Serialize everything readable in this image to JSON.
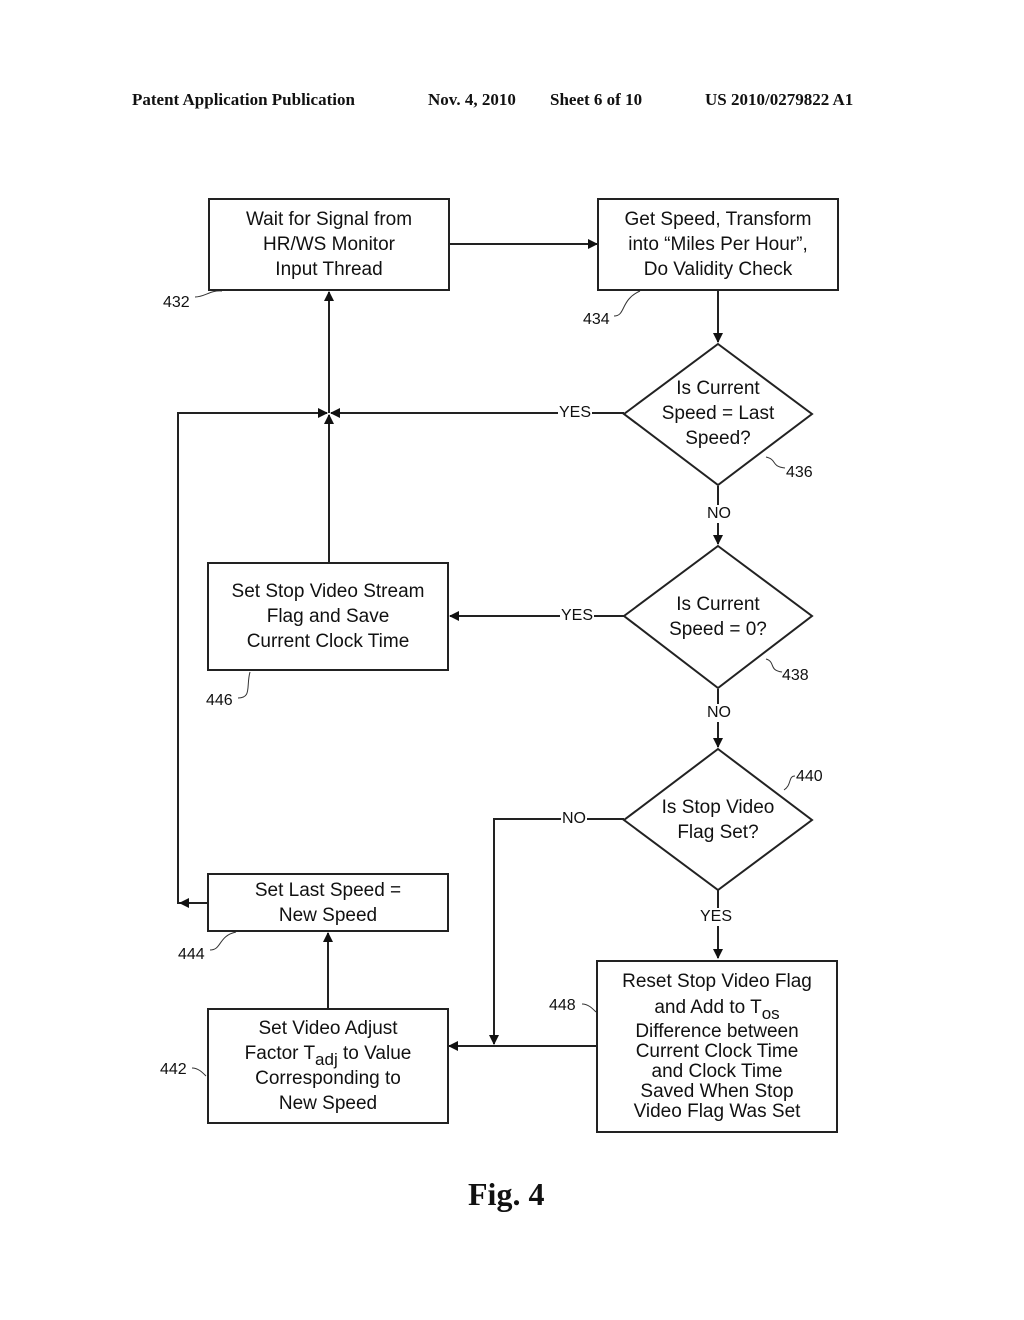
{
  "header": {
    "publication": "Patent Application Publication",
    "date": "Nov. 4, 2010",
    "sheet": "Sheet 6 of 10",
    "number": "US 2010/0279822 A1"
  },
  "figure_label": "Fig. 4",
  "nodes": {
    "n432": {
      "ref": "432",
      "lines": [
        "Wait for Signal from",
        "HR/WS Monitor",
        "Input Thread"
      ]
    },
    "n434": {
      "ref": "434",
      "lines": [
        "Get Speed, Transform",
        "into “Miles Per Hour”,",
        "Do Validity Check"
      ]
    },
    "n436": {
      "ref": "436",
      "lines": [
        "Is Current",
        "Speed = Last",
        "Speed?"
      ]
    },
    "n438": {
      "ref": "438",
      "lines": [
        "Is Current",
        "Speed = 0?"
      ]
    },
    "n440": {
      "ref": "440",
      "lines": [
        "Is Stop Video",
        "Flag Set?"
      ]
    },
    "n446": {
      "ref": "446",
      "lines": [
        "Set Stop Video Stream",
        "Flag and Save",
        "Current Clock Time"
      ]
    },
    "n444": {
      "ref": "444",
      "lines": [
        "Set Last Speed =",
        "New Speed"
      ]
    },
    "n442": {
      "ref": "442",
      "line1": "Set Video Adjust",
      "line2_pre": "Factor T",
      "line2_sub": "adj",
      "line2_post": " to Value",
      "line3": "Corresponding to",
      "line4": "New Speed"
    },
    "n448": {
      "ref": "448",
      "line1": "Reset Stop Video Flag",
      "line2_pre": "and Add to T",
      "line2_sub": "os",
      "lines_rest": [
        "Difference between",
        "Current Clock Time",
        "and Clock Time",
        "Saved When Stop",
        "Video Flag Was Set"
      ]
    }
  },
  "edge_labels": {
    "e436_yes": "YES",
    "e436_no": "NO",
    "e438_yes": "YES",
    "e438_no": "NO",
    "e440_no": "NO",
    "e440_yes": "YES"
  }
}
